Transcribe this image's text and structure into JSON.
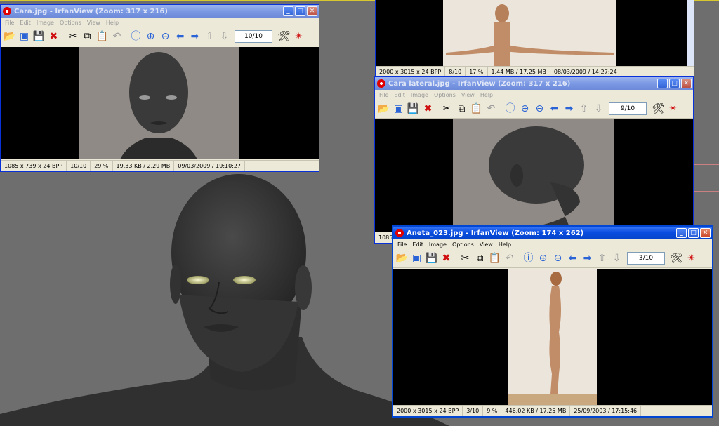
{
  "background": {
    "color": "#6e6e6e"
  },
  "windows": {
    "cara": {
      "title": "Cara.jpg - IrfanView (Zoom: 317 x 216)",
      "menu": [
        "File",
        "Edit",
        "Image",
        "Options",
        "View",
        "Help"
      ],
      "page": "10/10",
      "status": [
        "1085 x 739 x 24 BPP",
        "10/10",
        "29 %",
        "19.33 KB / 2.29 MB",
        "09/03/2009 / 19:10:27"
      ]
    },
    "aneta_top": {
      "status": [
        "2000 x 3015 x 24 BPP",
        "8/10",
        "17 %",
        "1.44 MB / 17.25 MB",
        "08/03/2009 / 14:27:24"
      ]
    },
    "cara_lateral": {
      "title": "Cara lateral.jpg - IrfanView (Zoom: 317 x 216)",
      "menu": [
        "File",
        "Edit",
        "Image",
        "Options",
        "View",
        "Help"
      ],
      "page": "9/10",
      "status_partial": "1085"
    },
    "aneta": {
      "title": "Aneta_023.jpg - IrfanView (Zoom: 174 x 262)",
      "menu": [
        "File",
        "Edit",
        "Image",
        "Options",
        "View",
        "Help"
      ],
      "page": "3/10",
      "status": [
        "2000 x 3015 x 24 BPP",
        "3/10",
        "9 %",
        "446.02 KB / 17.25 MB",
        "25/09/2003 / 17:15:46"
      ]
    }
  },
  "toolbar_icons": [
    "open-icon",
    "slideshow-icon",
    "save-icon",
    "delete-icon",
    "cut-icon",
    "copy-icon",
    "paste-icon",
    "undo-icon",
    "info-icon",
    "zoom-in-icon",
    "zoom-out-icon",
    "previous-icon",
    "next-icon",
    "first-page-icon",
    "last-page-icon",
    "settings-icon",
    "exit-icon"
  ],
  "window_buttons": [
    "minimize-icon",
    "maximize-icon",
    "close-icon"
  ]
}
